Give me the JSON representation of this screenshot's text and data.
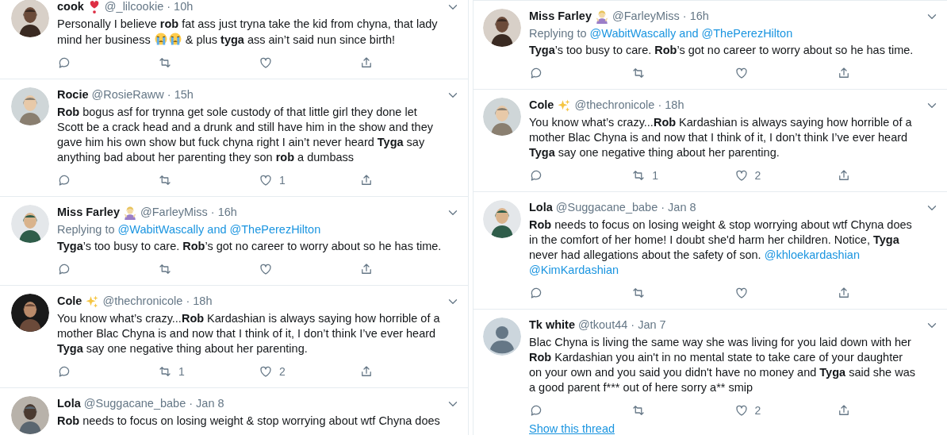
{
  "columns": [
    {
      "tweets": [
        {
          "avatar": {
            "kind": "picture"
          },
          "author": {
            "name": "cook",
            "badge": {
              "kind": "heart_exclamation"
            },
            "meta": "@_lilcookie · 10h"
          },
          "body": [
            {
              "kind": "plain",
              "text": "Personally I believe "
            },
            {
              "kind": "bold",
              "text": "rob"
            },
            {
              "kind": "plain",
              "text": " fat ass just tryna take the kid from chyna, that lady mind her business "
            },
            {
              "kind": "crying_emoji"
            },
            {
              "kind": "crying_emoji"
            },
            {
              "kind": "plain",
              "text": " & plus "
            },
            {
              "kind": "bold",
              "text": "tyga"
            },
            {
              "kind": "plain",
              "text": " ass ain’t said nun since birth!"
            }
          ],
          "actions": true
        },
        {
          "avatar": {
            "kind": "picture"
          },
          "author": {
            "name": "Rocie",
            "meta": "@RosieRaww · 15h"
          },
          "body": [
            {
              "kind": "bold",
              "text": "Rob"
            },
            {
              "kind": "plain",
              "text": " bogus asf for trynna get sole custody of that little girl they done let Scott be a crack head and a drunk and still have him in the show and they gave him his own show but fuck chyna right I ain’t never heard "
            },
            {
              "kind": "bold",
              "text": "Tyga"
            },
            {
              "kind": "plain",
              "text": " say anything bad about her parenting they son "
            },
            {
              "kind": "bold",
              "text": "rob"
            },
            {
              "kind": "plain",
              "text": " a dumbass"
            }
          ],
          "actions": true,
          "likes": "1"
        },
        {
          "avatar": {
            "kind": "picture"
          },
          "author": {
            "name": "Miss Farley",
            "badge": {
              "kind": "person_shrug"
            },
            "meta": "@FarleyMiss · 16h"
          },
          "replying": {
            "label": "Replying to",
            "targets": "@WabitWascally and @ThePerezHilton"
          },
          "body": [
            {
              "kind": "bold",
              "text": "Tyga"
            },
            {
              "kind": "plain",
              "text": "’s too busy to care. "
            },
            {
              "kind": "bold",
              "text": "Rob"
            },
            {
              "kind": "plain",
              "text": "’s got no career to worry about so he has time."
            }
          ],
          "actions": true
        },
        {
          "avatar": {
            "kind": "picture"
          },
          "author": {
            "name": "Cole",
            "badge": {
              "kind": "sparkles"
            },
            "meta": "@thechronicole · 18h"
          },
          "body": [
            {
              "kind": "plain",
              "text": "You know what’s crazy..."
            },
            {
              "kind": "bold",
              "text": "Rob"
            },
            {
              "kind": "plain",
              "text": " Kardashian is always saying how horrible of a mother Blac Chyna is and now that I think of it, I don’t think I’ve ever heard "
            },
            {
              "kind": "bold",
              "text": "Tyga"
            },
            {
              "kind": "plain",
              "text": " say one negative thing about her parenting."
            }
          ],
          "actions": true,
          "retweets": "1",
          "likes": "2"
        },
        {
          "avatar": {
            "kind": "picture"
          },
          "author": {
            "name": "Lola",
            "meta": "@Suggacane_babe · Jan 8"
          },
          "body": [
            {
              "kind": "bold",
              "text": "Rob"
            },
            {
              "kind": "plain",
              "text": " needs to focus on losing weight & stop worrying about wtf Chyna does"
            }
          ]
        }
      ]
    },
    {
      "tweets": [
        {
          "avatar": {
            "kind": "picture"
          },
          "author": {
            "name": "Miss Farley",
            "badge": {
              "kind": "person_shrug"
            },
            "meta": "@FarleyMiss · 16h"
          },
          "replying": {
            "label": "Replying to",
            "targets": "@WabitWascally and @ThePerezHilton"
          },
          "body": [
            {
              "kind": "bold",
              "text": "Tyga"
            },
            {
              "kind": "plain",
              "text": "’s too busy to care. "
            },
            {
              "kind": "bold",
              "text": "Rob"
            },
            {
              "kind": "plain",
              "text": "’s got no career to worry about so he has time."
            }
          ],
          "actions": true
        },
        {
          "avatar": {
            "kind": "picture"
          },
          "author": {
            "name": "Cole",
            "badge": {
              "kind": "sparkles"
            },
            "meta": "@thechronicole · 18h"
          },
          "body": [
            {
              "kind": "plain",
              "text": "You know what’s crazy..."
            },
            {
              "kind": "bold",
              "text": "Rob"
            },
            {
              "kind": "plain",
              "text": " Kardashian is always saying how horrible of a mother Blac Chyna is and now that I think of it, I don’t think I’ve ever heard "
            },
            {
              "kind": "bold",
              "text": "Tyga"
            },
            {
              "kind": "plain",
              "text": " say one negative thing about her parenting."
            }
          ],
          "actions": true,
          "retweets": "1",
          "likes": "2"
        },
        {
          "avatar": {
            "kind": "picture"
          },
          "author": {
            "name": "Lola",
            "meta": "@Suggacane_babe · Jan 8"
          },
          "body": [
            {
              "kind": "bold",
              "text": "Rob"
            },
            {
              "kind": "plain",
              "text": " needs to focus on losing weight & stop worrying about wtf Chyna does in the comfort of her home! I doubt she'd harm her children. Notice, "
            },
            {
              "kind": "bold",
              "text": "Tyga"
            },
            {
              "kind": "plain",
              "text": " never had allegations about the safety of son."
            }
          ],
          "mentions": [
            "@khloekardashian",
            "@KimKardashian"
          ],
          "actions": true
        },
        {
          "avatar": {
            "kind": "default"
          },
          "author": {
            "name": "Tk white",
            "meta": "@tkout44 · Jan 7"
          },
          "body": [
            {
              "kind": "plain",
              "text": "Blac Chyna is living the same way she was living for you laid down with her "
            },
            {
              "kind": "bold",
              "text": "Rob"
            },
            {
              "kind": "plain",
              "text": " Kardashian you ain't in no mental state to take care of your daughter on your own and you said you didn't have no money and "
            },
            {
              "kind": "bold",
              "text": "Tyga"
            },
            {
              "kind": "plain",
              "text": " said she was a good parent f*** out of here sorry a** smip"
            }
          ],
          "actions": true,
          "likes": "2",
          "show_thread": "Show this thread"
        }
      ]
    }
  ]
}
